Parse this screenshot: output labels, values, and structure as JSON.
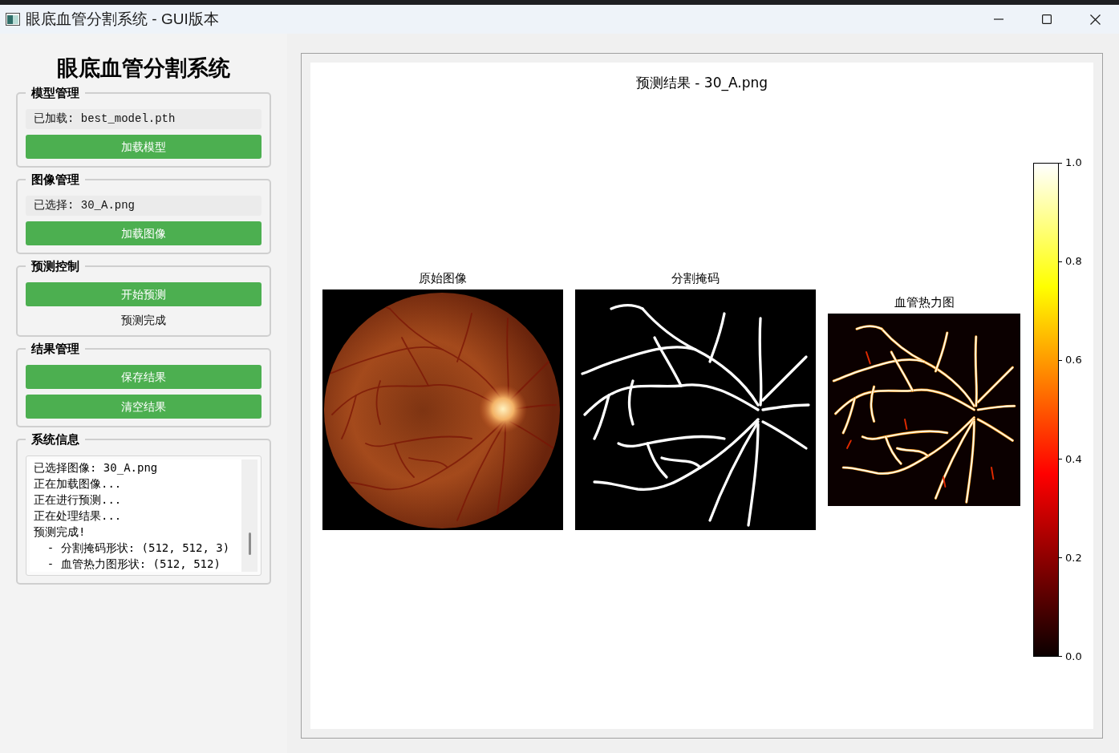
{
  "window": {
    "title": "眼底血管分割系统 - GUI版本"
  },
  "sidebar": {
    "title": "眼底血管分割系统",
    "groups": [
      {
        "title": "模型管理",
        "items": [
          {
            "kind": "info",
            "text": "已加载: best_model.pth"
          },
          {
            "kind": "button",
            "text": "加载模型"
          }
        ]
      },
      {
        "title": "图像管理",
        "items": [
          {
            "kind": "info",
            "text": "已选择: 30_A.png"
          },
          {
            "kind": "button",
            "text": "加载图像"
          }
        ]
      },
      {
        "title": "预测控制",
        "items": [
          {
            "kind": "button",
            "text": "开始预测"
          },
          {
            "kind": "status",
            "text": "预测完成"
          }
        ]
      },
      {
        "title": "结果管理",
        "items": [
          {
            "kind": "button",
            "text": "保存结果"
          },
          {
            "kind": "button",
            "text": "清空结果"
          }
        ]
      },
      {
        "title": "系统信息",
        "items": [
          {
            "kind": "log",
            "lines": [
              "已选择图像: 30_A.png",
              "正在加载图像...",
              "正在进行预测...",
              "正在处理结果...",
              "预测完成!",
              "  - 分割掩码形状: (512, 512, 3)",
              "  - 血管热力图形状: (512, 512)"
            ]
          }
        ]
      }
    ]
  },
  "figure": {
    "title": "预测结果 - 30_A.png",
    "panels": [
      {
        "kind": "photo",
        "title": "原始图像"
      },
      {
        "kind": "mask",
        "title": "分割掩码"
      },
      {
        "kind": "heatmap",
        "title": "血管热力图"
      }
    ],
    "colorbar": {
      "ticks": [
        "1.0",
        "0.8",
        "0.6",
        "0.4",
        "0.2",
        "0.0"
      ]
    }
  }
}
